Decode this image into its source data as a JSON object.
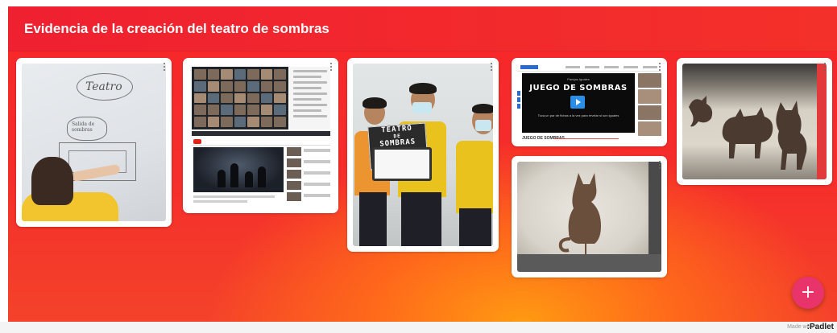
{
  "board": {
    "title": "Evidencia de la creación del teatro de sombras",
    "accent_color": "#f4302a",
    "gradient_center_color": "#ff9a12"
  },
  "posts": [
    {
      "id": "whiteboard",
      "image": "student-drawing-on-whiteboard",
      "whiteboard_text": "Teatro",
      "bubble_text": "Salida de sombras"
    },
    {
      "id": "video-call",
      "image": "video-conference-and-youtube-screenshot"
    },
    {
      "id": "students-sign",
      "image": "students-holding-sign",
      "sign_text": [
        "TEATRO",
        "DE",
        "SOMBRAS"
      ]
    },
    {
      "id": "game",
      "image": "shadow-matching-game-screenshot",
      "game_subtitle": "Parejas Iguales",
      "game_title": "JUEGO DE SOMBRAS",
      "game_hint": "Toca un par de fichas a la vez para revelar si son iguales",
      "game_name": "JUEGO DE SOMBRAS"
    },
    {
      "id": "cat-shadow",
      "image": "cat-silhouette-shadow"
    },
    {
      "id": "animals-shadow",
      "image": "animal-silhouettes-shadow-play"
    }
  ],
  "actions": {
    "add_post_label": "+",
    "add_post_color": "#e8336b"
  },
  "footer": {
    "made_with": "Made with",
    "brand": ":Padlet"
  }
}
